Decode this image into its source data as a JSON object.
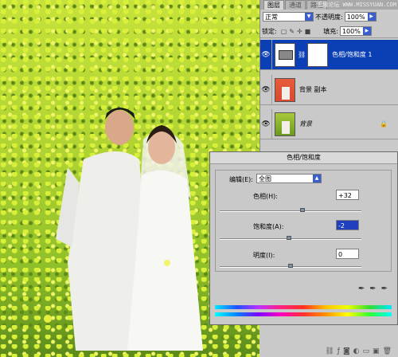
{
  "panel": {
    "tabs": [
      "图层",
      "通道",
      "路径"
    ],
    "watermark": "思缘论坛 WWW.MISSYUAN.COM",
    "blend_mode": "正常",
    "opacity_label": "不透明度:",
    "opacity_value": "100%",
    "lock_label": "锁定:",
    "fill_label": "填充:",
    "fill_value": "100%",
    "layers": [
      {
        "name": "色相/饱和度 1",
        "selected": true
      },
      {
        "name": "背景 副本",
        "selected": false
      },
      {
        "name": "背景",
        "selected": false
      }
    ]
  },
  "dialog": {
    "title": "色相/饱和度",
    "edit_label": "编辑(E):",
    "edit_value": "全图",
    "hue_label": "色相(H):",
    "hue_value": "+32",
    "hue_slider_value": 32,
    "sat_label": "饱和度(A):",
    "sat_value": "-2",
    "sat_slider_value": -2,
    "light_label": "明度(I):",
    "light_value": "0",
    "light_slider_value": 0
  }
}
